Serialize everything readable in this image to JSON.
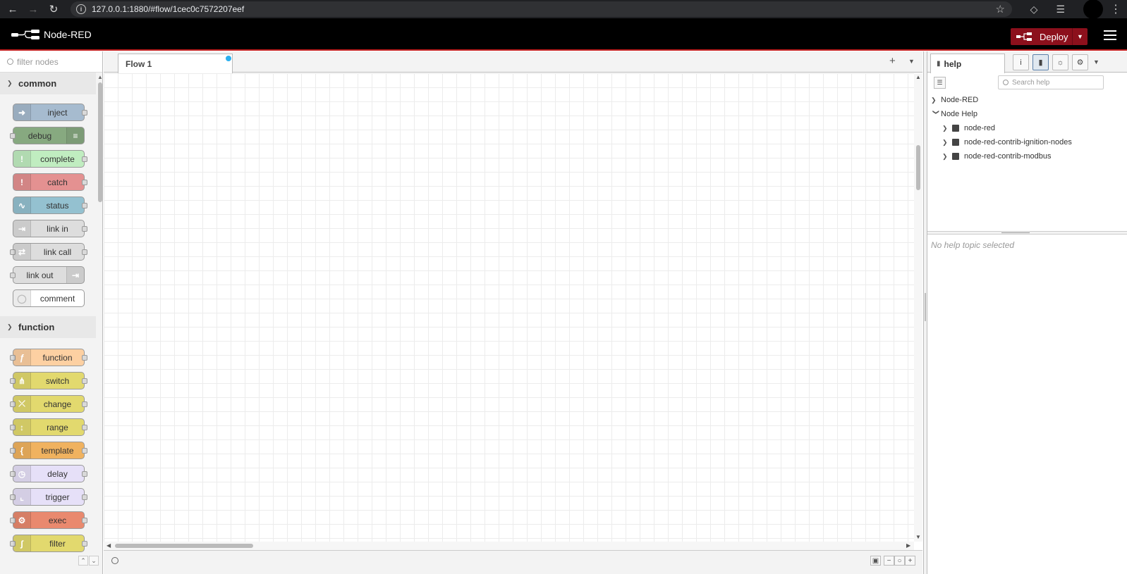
{
  "browser": {
    "url": "127.0.0.1:1880/#flow/1cec0c7572207eef"
  },
  "header": {
    "app_title": "Node-RED",
    "deploy_label": "Deploy",
    "deploy_color": "#8c101c"
  },
  "palette": {
    "filter_placeholder": "filter nodes",
    "categories": [
      {
        "title": "common",
        "nodes": [
          "inject",
          "debug",
          "complete",
          "catch",
          "status",
          "link in",
          "link call",
          "link out",
          "comment"
        ]
      },
      {
        "title": "function",
        "nodes": [
          "function",
          "switch",
          "change",
          "range",
          "template",
          "delay",
          "trigger",
          "exec",
          "filter"
        ]
      }
    ]
  },
  "workspace": {
    "tabs": [
      {
        "label": "Flow 1",
        "changed": true
      }
    ]
  },
  "sidebar": {
    "active_tab": "help",
    "search_placeholder": "Search help",
    "tree": [
      {
        "label": "Node-RED",
        "expanded": false
      },
      {
        "label": "Node Help",
        "expanded": true,
        "children": [
          "node-red",
          "node-red-contrib-ignition-nodes",
          "node-red-contrib-modbus"
        ]
      }
    ],
    "empty_message": "No help topic selected"
  }
}
